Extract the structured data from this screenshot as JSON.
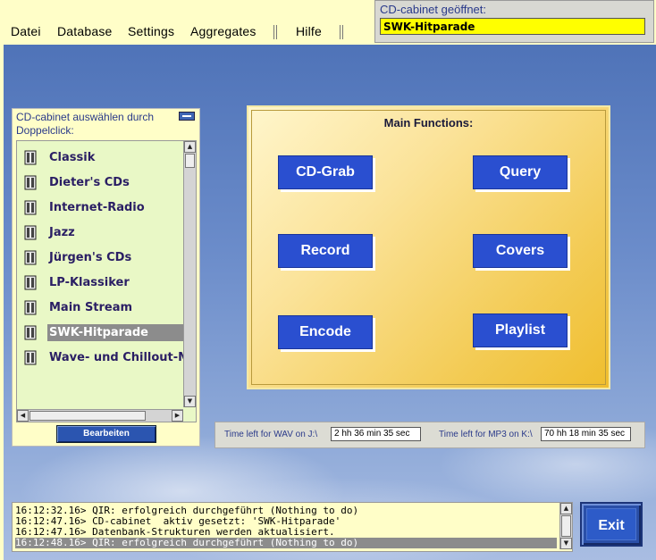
{
  "menu": {
    "items": [
      "Datei",
      "Database",
      "Settings",
      "Aggregates",
      "Hilfe"
    ]
  },
  "opened_panel": {
    "label": "CD-cabinet geöffnet:",
    "value": "SWK-Hitparade"
  },
  "cabinet_list": {
    "title": "CD-cabinet auswählen durch Doppelclick:",
    "items": [
      "Classik",
      "Dieter's CDs",
      "Internet-Radio",
      "Jazz",
      "Jürgen's CDs",
      "LP-Klassiker",
      "Main Stream",
      "SWK-Hitparade",
      "Wave- und Chillout-Mu"
    ],
    "selected": "SWK-Hitparade",
    "edit_button": "Bearbeiten"
  },
  "main_functions": {
    "title": "Main Functions:",
    "buttons": [
      "CD-Grab",
      "Query",
      "Record",
      "Covers",
      "Encode",
      "Playlist"
    ]
  },
  "time_left": {
    "wav_label": "Time left for WAV on J:\\",
    "wav_value": "2 hh 36 min 35 sec",
    "mp3_label": "Time left for MP3 on K:\\",
    "mp3_value": "70 hh 18 min 35 sec"
  },
  "log": {
    "lines": [
      "16:12:32.16> QIR: erfolgreich durchgeführt (Nothing to do)",
      "16:12:47.16> CD-cabinet  aktiv gesetzt: 'SWK-Hitparade'",
      "16:12:47.16> Datenbank-Strukturen werden aktualisiert.",
      "16:12:48.16> QIR: erfolgreich durchgeführt (Nothing to do)"
    ],
    "highlighted_index": 3
  },
  "exit_button": "Exit",
  "colors": {
    "accent_blue": "#2a4fd0",
    "highlight_yellow": "#ffff00",
    "list_background": "#e9f8c6",
    "panel_cream": "#fffec8"
  }
}
